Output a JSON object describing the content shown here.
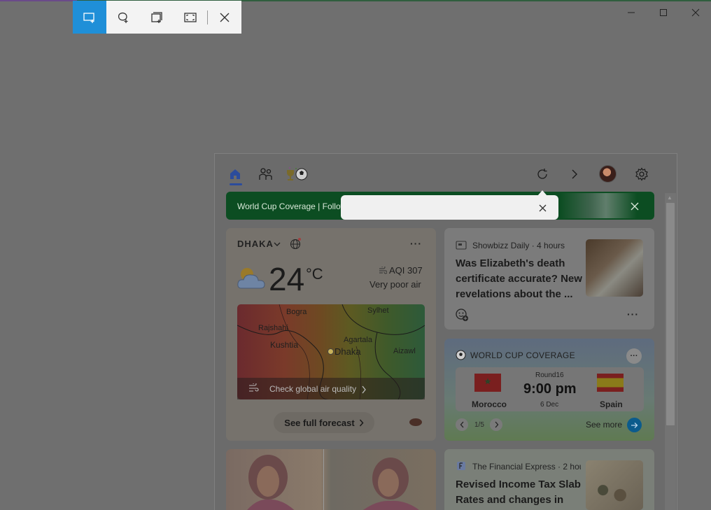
{
  "snip_toolbar": {
    "tools": [
      {
        "icon": "rectangle-snip-icon",
        "active": true
      },
      {
        "icon": "freeform-snip-icon",
        "active": false
      },
      {
        "icon": "window-snip-icon",
        "active": false
      },
      {
        "icon": "fullscreen-snip-icon",
        "active": false
      }
    ],
    "close_icon": "close-icon"
  },
  "window_controls": [
    "minimize-icon",
    "maximize-icon",
    "close-icon"
  ],
  "widgets": {
    "nav": {
      "icons": [
        "home-icon",
        "family-icon",
        "world-cup-icon"
      ],
      "right_icons": [
        "refresh-icon",
        "chevron-right-icon",
        "avatar",
        "gear-icon"
      ]
    },
    "banner": {
      "text": "World Cup Coverage | Follow"
    },
    "weather": {
      "city": "DHAKA",
      "temperature": "24",
      "unit": "°C",
      "aqi": "AQI 307",
      "aqi_desc": "Very poor air",
      "map_labels": {
        "bogra": "Bogra",
        "sylhet": "Sylhet",
        "rajshahi": "Rajshahi",
        "agartala": "Agartala",
        "kushtia": "Kushtia",
        "dhaka": "Dhaka",
        "aizawl": "Aizawl"
      },
      "map_link": "Check global air quality",
      "forecast_button": "See full forecast"
    },
    "news1": {
      "source": "Showbizz Daily · 4 hours",
      "headline": "Was Elizabeth's death certificate accurate? New revelations about the ..."
    },
    "world_cup": {
      "title": "WORLD CUP COVERAGE",
      "round": "Round16",
      "time": "9:00 pm",
      "date": "6 Dec",
      "team_home": "Morocco",
      "team_away": "Spain",
      "pager": "1/5",
      "see_more": "See more"
    },
    "news2": {
      "source": "The Financial Express · 2 hou",
      "headline": "Revised Income Tax Slab Rates and changes in"
    }
  }
}
